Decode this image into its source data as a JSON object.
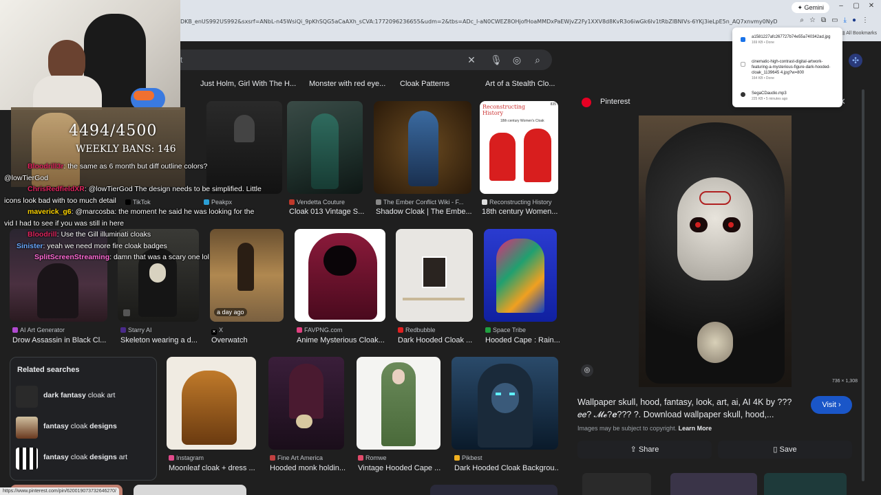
{
  "browser": {
    "gemini_label": "Gemini",
    "url": "DKB_enUS992US992&sxsrf=ANbL-n45WsiQi_9pKhSQG5aCaAXh_sCVA:1772096236655&udm=2&tbs=ADc_l-aN0CWEZ8OHjofHoaMMDxPaEWjvZ2Fy1XXV8d8KvR3o6iwGk6lv1tRbZlBNIVs-6YKj3ieLpE5n_AQ7xnvmy0NyDG6rqjTFTpNupInRB2Edc8Z3ZXmfwsujo4PqE9Hmt_3FG",
    "bookmarks_label": "All Bookmarks",
    "status_url": "https://www.pinterest.com/pin/620019073732646270/"
  },
  "downloads": [
    {
      "name": "a1581227afc267727b74e55a740342ad.jpg",
      "status": "169 KB • Done"
    },
    {
      "name": "cinematic-high-contrast-digital-artwork-featuring-a-mysterious-figure-dark-hooded-cloak_1139645 4.jpg?w=800",
      "status": "164 KB • Done"
    },
    {
      "name": "SegaCDaudio.mp3",
      "status": "225 KB • 5 minutes ago"
    }
  ],
  "search": {
    "query": "t"
  },
  "chips": [
    "Just Holm, Girl With The H...",
    "Monster with red eye...",
    "Cloak Patterns",
    "Art of a Stealth Clo..."
  ],
  "row1": [
    {
      "source": "TikTok",
      "title": ""
    },
    {
      "source": "Peakpx",
      "title": ""
    },
    {
      "source": "Vendetta Couture",
      "title": "Cloak 013 Vintage S..."
    },
    {
      "source": "The Ember Conflict Wiki - F...",
      "title": "Shadow Cloak | The Embe..."
    },
    {
      "source": "Reconstructing History",
      "title": "18th century Women..."
    }
  ],
  "row1_tile_text": {
    "history_title": "Reconstructing History",
    "history_sub": "18th century Women's Cloak",
    "history_num": "835"
  },
  "row2": [
    {
      "source": "AI Art Generator",
      "title": "Drow Assassin in Black Cl..."
    },
    {
      "source": "Starry AI",
      "title": "Skeleton wearing a d..."
    },
    {
      "source": "X",
      "title": "Overwatch",
      "badge": "a day ago"
    },
    {
      "source": "FAVPNG.com",
      "title": "Anime Mysterious Cloak..."
    },
    {
      "source": "Redbubble",
      "title": "Dark Hooded Cloak ..."
    },
    {
      "source": "Space Tribe",
      "title": "Hooded Cape : Rain..."
    }
  ],
  "row3": [
    {
      "source": "Instagram",
      "title": "Moonleaf cloak + dress ..."
    },
    {
      "source": "Fine Art America",
      "title": "Hooded monk holdin..."
    },
    {
      "source": "Romwe",
      "title": "Vintage Hooded Cape ..."
    },
    {
      "source": "Pikbest",
      "title": "Dark Hooded Cloak Backgrou..."
    }
  ],
  "related": {
    "heading": "Related searches",
    "items": [
      {
        "bold": "dark fantasy",
        "rest": " cloak art"
      },
      {
        "bold": "fantasy",
        "rest": " cloak ",
        "bold2": "designs"
      },
      {
        "bold": "fantasy",
        "rest": " cloak ",
        "bold2": "designs",
        "rest2": " art"
      }
    ]
  },
  "panel": {
    "source": "Pinterest",
    "dimensions": "736 × 1,308",
    "title": "Wallpaper skull, hood, fantasy, look, art, ai, AI 4K by ???𝑒𝑒? 𝓜𝓮?𝒆??? ?. Download wallpaper skull, hood,...",
    "copyright": "Images may be subject to copyright.",
    "learn_more": "Learn More",
    "visit": "Visit",
    "share": "Share",
    "save": "Save"
  },
  "stream": {
    "ban_count": "4494/4500",
    "weekly_bans": "WEEKLY BANS: 146",
    "chat": [
      {
        "user": "Bloodrill3r",
        "color": "#e0245e",
        "msg": "the same as 6 month but diff outline colors?"
      },
      {
        "user": "",
        "color": "#ffffff",
        "msg": "@lowTierGod"
      },
      {
        "user": "ChrisRedfieldXR",
        "color": "#e0245e",
        "msg": "@lowTierGod The design needs to be simplified. Little"
      },
      {
        "user": "",
        "color": "#ffffff",
        "msg": "icons look bad with too much detail"
      },
      {
        "user": "maverick_g6",
        "color": "#ffd400",
        "msg": "@marcosba: the moment he said he was looking for the"
      },
      {
        "user": "",
        "color": "#ffffff",
        "msg": "vid I had to see if you was still in here"
      },
      {
        "user": "Bloodrill",
        "color": "#e0245e",
        "msg": "Use the Gill illuminati cloaks"
      },
      {
        "user": "Sinister",
        "color": "#6aa9ff",
        "msg": "yeah we need more fire cloak badges"
      },
      {
        "user": "SplitScreenStreaming",
        "color": "#ff6ad5",
        "msg": "damn that was a scary one lol"
      }
    ]
  }
}
